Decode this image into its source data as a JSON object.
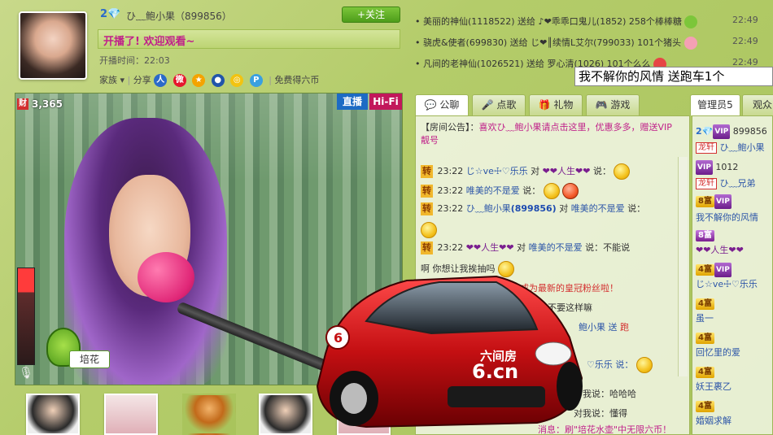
{
  "host": {
    "level": "2",
    "name": "ひ﹏鲍小果（899856）",
    "follow_label": "+关注",
    "welcome": "开播了! 欢迎观看~",
    "airtime": "开播时间：22:03",
    "family_label": "家族",
    "share_label": "分享",
    "coins_label": "免费得六币"
  },
  "video": {
    "live_badge": "直播",
    "hifi_badge": "Hi-Fi",
    "wealth_badge": "财",
    "wealth_value": "3,365",
    "flower_label": "培花"
  },
  "gift_log": [
    {
      "text": "• 美丽的神仙(1118522) 送给 ♪❤乖乖口鬼儿(1852) 258个棒棒糖",
      "time": "22:49",
      "icon_color": "#7cc63a"
    },
    {
      "text": "• 骁虎&使者(699830) 送给 じ❤║续情L艾尔(799033) 101个猪头",
      "time": "22:49",
      "icon_color": "#f4a0b4"
    },
    {
      "text": "• 凡间的老神仙(1026521) 送给 罗心清(1026) 101个么么",
      "time": "22:49",
      "icon_color": "#e64545"
    }
  ],
  "ticker": "我不解你的风情  送跑车1个",
  "chat_tabs": [
    "公聊",
    "点歌",
    "礼物",
    "游戏"
  ],
  "chat": {
    "announcement_label": "【房间公告】：",
    "announcement": "喜欢ひ﹏鲍小果请点击这里，优惠多多，赠送VIP靓号",
    "lines": [
      {
        "zhuan": "转",
        "time": "23:22",
        "from": "じ☆ve☩♡乐乐",
        "to_label": "对",
        "to": "❤❤人生❤❤",
        "say": "说："
      },
      {
        "zhuan": "转",
        "time": "23:22",
        "from": "唯美的不是爱",
        "to_label": "",
        "to": "",
        "say": "说："
      },
      {
        "zhuan": "转",
        "time": "23:22",
        "from": "ひ﹏鲍小果",
        "id": "(899856)",
        "to_label": "对",
        "to": "唯美的不是爱",
        "say": "说："
      },
      {
        "zhuan": "转",
        "time": "23:22",
        "from": "❤❤人生❤❤",
        "to_label": "对",
        "to": "唯美的不是爱",
        "say": "说：不能说"
      },
      {
        "text": "啊  你想让我挨抽吗"
      },
      {
        "text": "的风情\"成为最新的皇冠粉丝啦！"
      },
      {
        "text": "爱：不要这样嘛"
      },
      {
        "text": "鲍小果  送",
        "tail": "跑"
      },
      {
        "text": "♡乐乐  说："
      },
      {
        "text": "对我说：哈哈哈"
      },
      {
        "text": "对我说：懂得"
      },
      {
        "text": "消息：刷\"培花水壶\"中无限六币！"
      }
    ]
  },
  "user_tabs": [
    "管理员5",
    "观众"
  ],
  "users": [
    {
      "rank": "2",
      "vip": "VIP",
      "name": "899856"
    },
    {
      "long": "龙轩",
      "name": "ひ﹏鲍小果"
    },
    {
      "vip": "VIP",
      "name": "1012"
    },
    {
      "long": "龙轩",
      "name": "ひ﹏兄弟"
    },
    {
      "rank": "8富",
      "vip": "VIP",
      "name": ""
    },
    {
      "name": "我不解你的风情"
    },
    {
      "rank": "8富",
      "name": ""
    },
    {
      "name": "❤❤人生❤❤"
    },
    {
      "rank": "4富",
      "vip": "VIP",
      "name": ""
    },
    {
      "name": "じ☆ve☩♡乐乐"
    },
    {
      "rank": "4富",
      "name": ""
    },
    {
      "name": "虽一"
    },
    {
      "rank": "4富",
      "name": ""
    },
    {
      "name": "回忆里的爱"
    },
    {
      "rank": "4富",
      "name": ""
    },
    {
      "name": "妖王裹乙"
    },
    {
      "rank": "4富",
      "name": ""
    },
    {
      "name": "婚姻求解"
    }
  ],
  "car_gift": {
    "plate_text": "六间房",
    "domain_text": "6.cn",
    "number": "6"
  }
}
